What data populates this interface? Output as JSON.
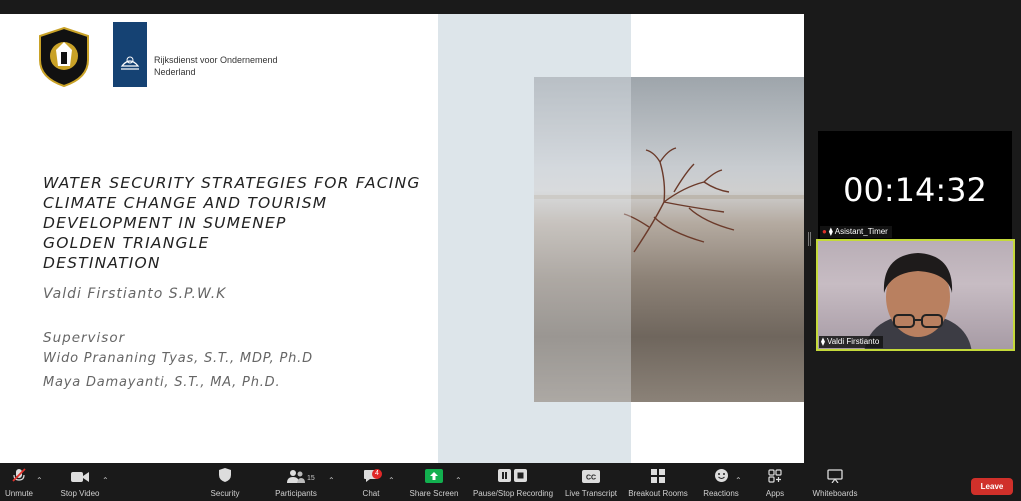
{
  "slide": {
    "org_name_line1": "Rijksdienst voor Ondernemend",
    "org_name_line2": "Nederland",
    "title": "WATER SECURITY STRATEGIES FOR FACING CLIMATE CHANGE AND TOURISM DEVELOPMENT IN SUMENEP GOLDEN TRIANGLE DESTINATION",
    "title_lines": [
      "WATER SECURITY STRATEGIES FOR FACING",
      "CLIMATE CHANGE AND TOURISM",
      "DEVELOPMENT IN SUMENEP",
      "GOLDEN TRIANGLE",
      "DESTINATION"
    ],
    "author": "Valdi Firstianto S.P.W.K",
    "supervisor_label": "Supervisor",
    "supervisor_1": "Wido Prananing Tyas, S.T., MDP, Ph.D",
    "supervisor_2": "Maya Damayanti, S.T., MA, Ph.D."
  },
  "participants": {
    "timer": {
      "value": "00:14:32",
      "name": "Asistant_Timer"
    },
    "self": {
      "name": "Valdi Firstianto"
    }
  },
  "toolbar": {
    "unmute": "Unmute",
    "stop_video": "Stop Video",
    "security": "Security",
    "participants": "Participants",
    "participants_count": "15",
    "chat": "Chat",
    "chat_badge": "4",
    "share_screen": "Share Screen",
    "record": "Pause/Stop Recording",
    "live_transcript": "Live Transcript",
    "breakout_rooms": "Breakout Rooms",
    "reactions": "Reactions",
    "apps": "Apps",
    "whiteboards": "Whiteboards",
    "leave": "Leave"
  },
  "colors": {
    "leave": "#d0302a",
    "active_speaker_border": "#c4d93a",
    "share_screen": "#12b04f",
    "muted": "#e0302a"
  }
}
